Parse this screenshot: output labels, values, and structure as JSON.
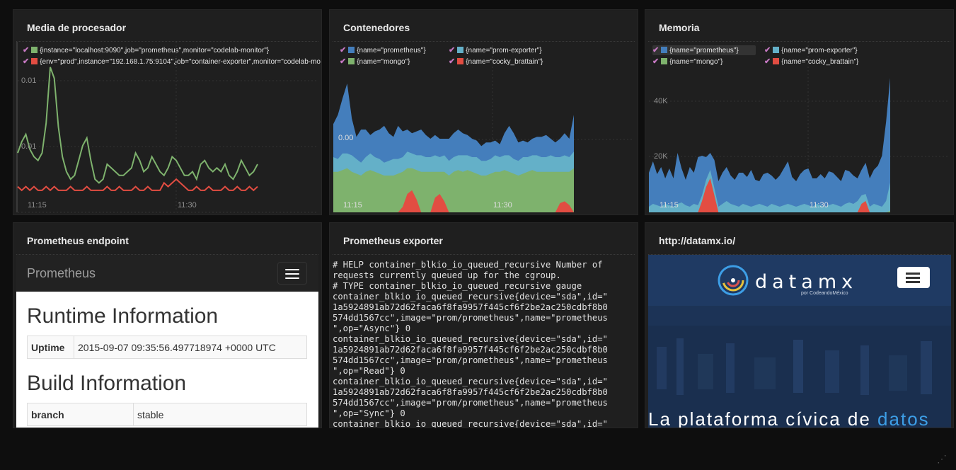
{
  "panels": {
    "cpu": {
      "title": "Media de procesador",
      "legend": [
        {
          "label": "{instance=\"localhost:9090\",job=\"prometheus\",monitor=\"codelab-monitor\"}",
          "color": "#7eb26d"
        },
        {
          "label": "{env=\"prod\",instance=\"192.168.1.75:9104\",job=\"container-exporter\",monitor=\"codelab-mo",
          "color": "#e24d42"
        }
      ],
      "y_ticks": [
        "0.01",
        "0.01"
      ],
      "x_ticks": [
        "11:15",
        "11:30"
      ]
    },
    "containers": {
      "title": "Contenedores",
      "legend": [
        {
          "label": "{name=\"prometheus\"}",
          "color": "#447ebc"
        },
        {
          "label": "{name=\"prom-exporter\"}",
          "color": "#64b0c8"
        },
        {
          "label": "{name=\"mongo\"}",
          "color": "#7eb26d"
        },
        {
          "label": "{name=\"cocky_brattain\"}",
          "color": "#e24d42"
        }
      ],
      "y_ticks": [
        "0.00"
      ],
      "x_ticks": [
        "11:15",
        "11:30"
      ]
    },
    "memory": {
      "title": "Memoria",
      "legend": [
        {
          "label": "{name=\"prometheus\"}",
          "color": "#447ebc"
        },
        {
          "label": "{name=\"prom-exporter\"}",
          "color": "#64b0c8"
        },
        {
          "label": "{name=\"mongo\"}",
          "color": "#7eb26d"
        },
        {
          "label": "{name=\"cocky_brattain\"}",
          "color": "#e24d42"
        }
      ],
      "y_ticks": [
        "40K",
        "20K"
      ],
      "x_ticks": [
        "11:15",
        "11:30"
      ]
    },
    "endpoint": {
      "title": "Prometheus endpoint",
      "brand": "Prometheus",
      "runtime_heading": "Runtime Information",
      "runtime_rows": [
        {
          "key": "Uptime",
          "value": "2015-09-07 09:35:56.497718974 +0000 UTC"
        }
      ],
      "build_heading": "Build Information",
      "build_rows": [
        {
          "key": "branch",
          "value": "stable"
        }
      ]
    },
    "exporter": {
      "title": "Prometheus exporter",
      "text": "# HELP container_blkio_io_queued_recursive Number of\nrequests currently queued up for the cgroup.\n# TYPE container_blkio_io_queued_recursive gauge\ncontainer_blkio_io_queued_recursive{device=\"sda\",id=\"\n1a5924891ab72d62faca6f8fa9957f445cf6f2be2ac250cdbf8b0\n574dd1567cc\",image=\"prom/prometheus\",name=\"prometheus\n\",op=\"Async\"} 0\ncontainer_blkio_io_queued_recursive{device=\"sda\",id=\"\n1a5924891ab72d62faca6f8fa9957f445cf6f2be2ac250cdbf8b0\n574dd1567cc\",image=\"prom/prometheus\",name=\"prometheus\n\",op=\"Read\"} 0\ncontainer_blkio_io_queued_recursive{device=\"sda\",id=\"\n1a5924891ab72d62faca6f8fa9957f445cf6f2be2ac250cdbf8b0\n574dd1567cc\",image=\"prom/prometheus\",name=\"prometheus\n\",op=\"Sync\"} 0\ncontainer_blkio_io_queued_recursive{device=\"sda\",id=\""
    },
    "datamx": {
      "title": "http://datamx.io/",
      "logo_text": "datamx",
      "logo_sub": "por CodeandoMéxico",
      "headline": "La plataforma cívica de ",
      "headline_highlight": "datos"
    }
  },
  "chart_data": [
    {
      "type": "line",
      "title": "Media de procesador",
      "x_ticks": [
        "11:15",
        "11:30"
      ],
      "series": [
        {
          "name": "{instance=\"localhost:9090\",job=\"prometheus\",monitor=\"codelab-monitor\"}",
          "color": "#7eb26d",
          "values": [
            0.0098,
            0.0101,
            0.0103,
            0.0099,
            0.0097,
            0.0096,
            0.0098,
            0.0106,
            0.0121,
            0.0118,
            0.0105,
            0.0097,
            0.0093,
            0.0091,
            0.0092,
            0.0096,
            0.01,
            0.0102,
            0.0096,
            0.0091,
            0.009,
            0.0091,
            0.0095,
            0.0094,
            0.0093,
            0.0092,
            0.0092,
            0.0093,
            0.0094,
            0.0098,
            0.0096,
            0.0093,
            0.0094,
            0.0097,
            0.0095,
            0.0093,
            0.0092,
            0.0094,
            0.0097,
            0.0096,
            0.0094,
            0.0092,
            0.0092,
            0.0093,
            0.0091,
            0.0095,
            0.0096,
            0.0094,
            0.0093,
            0.0094,
            0.0093,
            0.0095,
            0.0092,
            0.0091,
            0.0093,
            0.0096,
            0.0094,
            0.0092,
            0.0093,
            0.0095
          ]
        },
        {
          "name": "{env=\"prod\",instance=\"192.168.1.75:9104\",job=\"container-exporter\",monitor=\"codelab-mo",
          "color": "#e24d42",
          "values": [
            0.0089,
            0.0088,
            0.0089,
            0.0088,
            0.0089,
            0.0088,
            0.0088,
            0.0089,
            0.0088,
            0.0089,
            0.0088,
            0.0088,
            0.0088,
            0.0089,
            0.0088,
            0.0088,
            0.0088,
            0.0089,
            0.0088,
            0.0088,
            0.0088,
            0.0088,
            0.0089,
            0.0088,
            0.0088,
            0.0089,
            0.0088,
            0.0088,
            0.0088,
            0.0089,
            0.0088,
            0.0088,
            0.0089,
            0.0088,
            0.0088,
            0.0088,
            0.009,
            0.0089,
            0.009,
            0.0091,
            0.009,
            0.0089,
            0.0088,
            0.0088,
            0.0089,
            0.0088,
            0.0088,
            0.0089,
            0.0088,
            0.0088,
            0.0088,
            0.0089,
            0.0088,
            0.0088,
            0.0089,
            0.0088,
            0.0088,
            0.0089,
            0.0088,
            0.0089
          ]
        }
      ]
    },
    {
      "type": "area",
      "title": "Contenedores",
      "stacked": true,
      "x_ticks": [
        "11:15",
        "11:30"
      ],
      "series": [
        {
          "name": "{name=\"cocky_brattain\"}",
          "color": "#e24d42",
          "values": [
            0,
            0,
            0,
            0,
            0,
            0,
            0,
            0,
            0,
            0,
            0,
            0,
            0,
            0,
            0,
            3,
            10,
            12,
            7,
            0,
            0,
            0,
            8,
            10,
            6,
            0,
            0,
            0,
            0,
            0,
            0,
            0,
            0,
            0,
            0,
            0,
            0,
            0,
            0,
            0,
            0,
            0,
            0,
            0,
            0,
            0,
            0,
            0,
            0,
            5,
            6,
            4,
            0
          ]
        },
        {
          "name": "{name=\"mongo\"}",
          "color": "#7eb26d",
          "values": [
            22,
            22,
            23,
            24,
            22,
            21,
            20,
            22,
            23,
            22,
            21,
            20,
            20,
            20,
            21,
            19,
            14,
            12,
            16,
            22,
            22,
            22,
            14,
            12,
            16,
            20,
            22,
            23,
            22,
            23,
            22,
            21,
            20,
            20,
            21,
            22,
            22,
            23,
            22,
            21,
            20,
            21,
            22,
            23,
            22,
            22,
            22,
            22,
            22,
            17,
            16,
            18,
            24
          ]
        },
        {
          "name": "{name=\"prom-exporter\"}",
          "color": "#64b0c8",
          "values": [
            8,
            7,
            9,
            8,
            9,
            8,
            7,
            8,
            9,
            8,
            8,
            7,
            8,
            9,
            8,
            8,
            9,
            8,
            8,
            9,
            8,
            8,
            9,
            8,
            9,
            8,
            8,
            8,
            9,
            8,
            8,
            9,
            8,
            8,
            8,
            9,
            8,
            8,
            9,
            8,
            8,
            9,
            8,
            8,
            9,
            8,
            8,
            9,
            8,
            8,
            9,
            8,
            9
          ]
        },
        {
          "name": "{name=\"prometheus\"}",
          "color": "#447ebc",
          "values": [
            18,
            24,
            30,
            38,
            20,
            12,
            18,
            15,
            10,
            14,
            16,
            20,
            15,
            12,
            18,
            14,
            12,
            11,
            13,
            14,
            12,
            10,
            11,
            10,
            9,
            12,
            13,
            14,
            12,
            11,
            10,
            9,
            8,
            10,
            9,
            8,
            7,
            12,
            16,
            14,
            10,
            9,
            8,
            9,
            10,
            11,
            12,
            9,
            8,
            10,
            12,
            10,
            20
          ]
        }
      ]
    },
    {
      "type": "area",
      "title": "Memoria",
      "stacked": true,
      "y_ticks": [
        "20K",
        "40K"
      ],
      "x_ticks": [
        "11:15",
        "11:30"
      ],
      "series": [
        {
          "name": "{name=\"cocky_brattain\"}",
          "color": "#e24d42",
          "values": [
            0,
            0,
            0,
            0,
            0,
            0,
            0,
            0,
            0,
            0,
            0,
            0,
            0,
            4000,
            9000,
            12000,
            6000,
            0,
            0,
            0,
            0,
            0,
            0,
            0,
            0,
            0,
            0,
            0,
            0,
            0,
            0,
            0,
            0,
            0,
            0,
            0,
            0,
            0,
            0,
            0,
            0,
            0,
            0,
            0,
            0,
            0,
            0,
            0,
            0,
            0,
            0,
            0,
            3000,
            4000,
            0,
            0,
            0,
            0,
            0,
            0
          ]
        },
        {
          "name": "{name=\"mongo\"}",
          "color": "#7eb26d",
          "values": [
            0,
            0,
            0,
            0,
            0,
            0,
            0,
            0,
            0,
            0,
            0,
            0,
            0,
            0,
            0,
            0,
            0,
            0,
            0,
            0,
            0,
            0,
            0,
            0,
            0,
            0,
            0,
            0,
            0,
            0,
            0,
            0,
            0,
            0,
            0,
            0,
            0,
            0,
            0,
            0,
            0,
            0,
            0,
            0,
            0,
            0,
            0,
            0,
            0,
            0,
            0,
            0,
            0,
            0,
            0,
            0,
            0,
            0,
            0,
            500
          ]
        },
        {
          "name": "{name=\"prom-exporter\"}",
          "color": "#64b0c8",
          "values": [
            2000,
            3000,
            2500,
            2000,
            3000,
            2500,
            2000,
            3000,
            3500,
            2500,
            2000,
            3000,
            2500,
            2000,
            2500,
            3000,
            2500,
            2000,
            3000,
            4000,
            3000,
            2500,
            2000,
            3000,
            2500,
            2000,
            2500,
            3000,
            2500,
            2000,
            3000,
            2500,
            2000,
            2500,
            3000,
            2500,
            2000,
            2500,
            3000,
            2500,
            2000,
            3000,
            2500,
            2000,
            2500,
            3000,
            2500,
            2000,
            3000,
            3500,
            3000,
            4000,
            3000,
            2500,
            2000,
            3000,
            2500,
            2000,
            4000,
            10000
          ]
        },
        {
          "name": "{name=\"prometheus\"}",
          "color": "#447ebc",
          "values": [
            12000,
            15000,
            11000,
            14000,
            9000,
            13000,
            10000,
            18000,
            12000,
            9000,
            14000,
            11000,
            17000,
            14000,
            8000,
            6000,
            10000,
            9000,
            11000,
            12000,
            10000,
            9000,
            12000,
            11000,
            10000,
            13000,
            9000,
            8000,
            11000,
            12000,
            10000,
            9000,
            11000,
            13000,
            15000,
            10000,
            9000,
            11000,
            12000,
            13000,
            10000,
            9000,
            11000,
            10000,
            12000,
            11000,
            10000,
            9000,
            12000,
            11000,
            10000,
            8000,
            9000,
            11000,
            10000,
            12000,
            14000,
            18000,
            28000,
            37000
          ]
        }
      ]
    }
  ],
  "corner_icon": "resize-handle-icon"
}
